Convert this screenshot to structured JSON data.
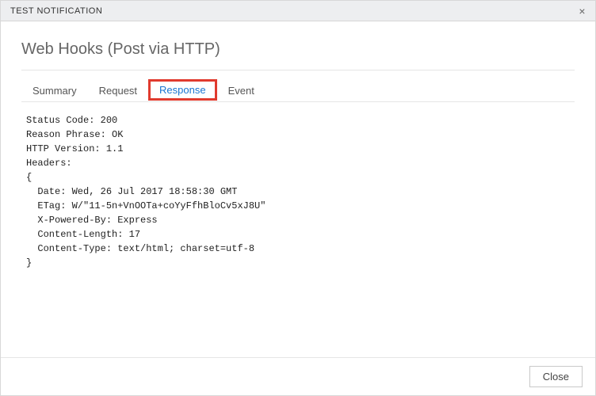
{
  "window": {
    "title": "TEST NOTIFICATION",
    "close_glyph": "×"
  },
  "header": {
    "title": "Web Hooks (Post via HTTP)"
  },
  "tabs": [
    {
      "label": "Summary",
      "active": false
    },
    {
      "label": "Request",
      "active": false
    },
    {
      "label": "Response",
      "active": true
    },
    {
      "label": "Event",
      "active": false
    }
  ],
  "response": {
    "status_code": "200",
    "reason_phrase": "OK",
    "http_version": "1.1",
    "headers": {
      "Date": "Wed, 26 Jul 2017 18:58:30 GMT",
      "ETag": "W/\"11-5n+VnOOTa+coYyFfhBloCv5xJ8U\"",
      "X-Powered-By": "Express",
      "Content-Length": "17",
      "Content-Type": "text/html; charset=utf-8"
    },
    "raw_text": "Status Code: 200\nReason Phrase: OK\nHTTP Version: 1.1\nHeaders:\n{\n  Date: Wed, 26 Jul 2017 18:58:30 GMT\n  ETag: W/\"11-5n+VnOOTa+coYyFfhBloCv5xJ8U\"\n  X-Powered-By: Express\n  Content-Length: 17\n  Content-Type: text/html; charset=utf-8\n}"
  },
  "footer": {
    "close_label": "Close"
  }
}
